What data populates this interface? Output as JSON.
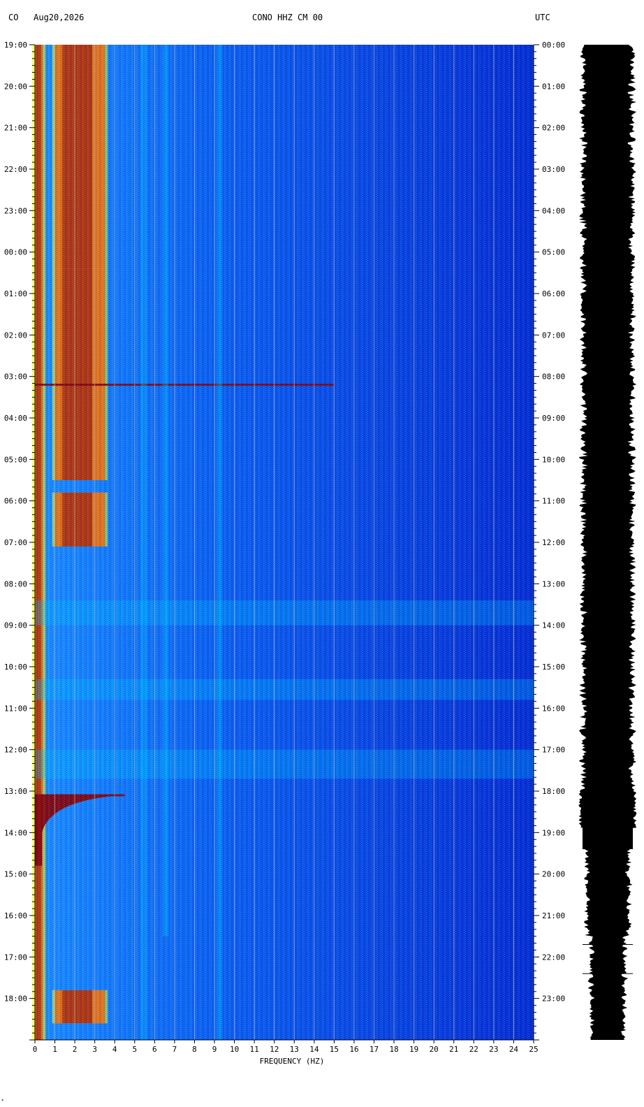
{
  "header": {
    "network": "CO",
    "date": "Aug20,2026",
    "station": "CONO HHZ CM 00",
    "timezone_label": "UTC"
  },
  "chart_data": {
    "type": "heatmap",
    "title": "CONO HHZ CM 00",
    "xlabel": "FREQUENCY (HZ)",
    "x_ticks": [
      "0",
      "1",
      "2",
      "3",
      "4",
      "5",
      "6",
      "7",
      "8",
      "9",
      "10",
      "11",
      "12",
      "13",
      "14",
      "15",
      "16",
      "17",
      "18",
      "19",
      "20",
      "21",
      "22",
      "23",
      "24",
      "25"
    ],
    "xlim": [
      0,
      25
    ],
    "y_left_ticks": [
      "19:00",
      "20:00",
      "21:00",
      "22:00",
      "23:00",
      "00:00",
      "01:00",
      "02:00",
      "03:00",
      "04:00",
      "05:00",
      "06:00",
      "07:00",
      "08:00",
      "09:00",
      "10:00",
      "11:00",
      "12:00",
      "13:00",
      "14:00",
      "15:00",
      "16:00",
      "17:00",
      "18:00"
    ],
    "y_right_ticks": [
      "00:00",
      "01:00",
      "02:00",
      "03:00",
      "04:00",
      "05:00",
      "06:00",
      "07:00",
      "08:00",
      "09:00",
      "10:00",
      "11:00",
      "12:00",
      "13:00",
      "14:00",
      "15:00",
      "16:00",
      "17:00",
      "18:00",
      "19:00",
      "20:00",
      "21:00",
      "22:00",
      "23:00"
    ],
    "y_right_label": "UTC",
    "hours_shown": 24,
    "colormap": [
      "#00008f",
      "#0050ff",
      "#00c8ff",
      "#ffff00",
      "#ff6400",
      "#8f0000"
    ],
    "features": [
      {
        "kind": "band",
        "f_from": 0,
        "f_to": 0.4,
        "hours": [
          0,
          24
        ],
        "level": "high"
      },
      {
        "kind": "band",
        "f_from": 1,
        "f_to": 3.5,
        "hours": [
          0,
          5.4
        ],
        "level": "high"
      },
      {
        "kind": "band",
        "f_from": 1,
        "f_to": 3.5,
        "hours": [
          5.4,
          10.5
        ],
        "level": "high"
      },
      {
        "kind": "band",
        "f_from": 1,
        "f_to": 3.5,
        "hours": [
          10.8,
          12.1
        ],
        "level": "high"
      },
      {
        "kind": "event",
        "hour": 8.2,
        "f_to": 15,
        "label": "event line"
      },
      {
        "kind": "event",
        "hour": 18.1,
        "f_to": 4.5,
        "label": "large event"
      },
      {
        "kind": "band",
        "f_from": 1,
        "f_to": 3.5,
        "hours": [
          22.8,
          23.6
        ],
        "level": "high"
      }
    ],
    "trace_color": "#000000"
  },
  "footnote": "*"
}
